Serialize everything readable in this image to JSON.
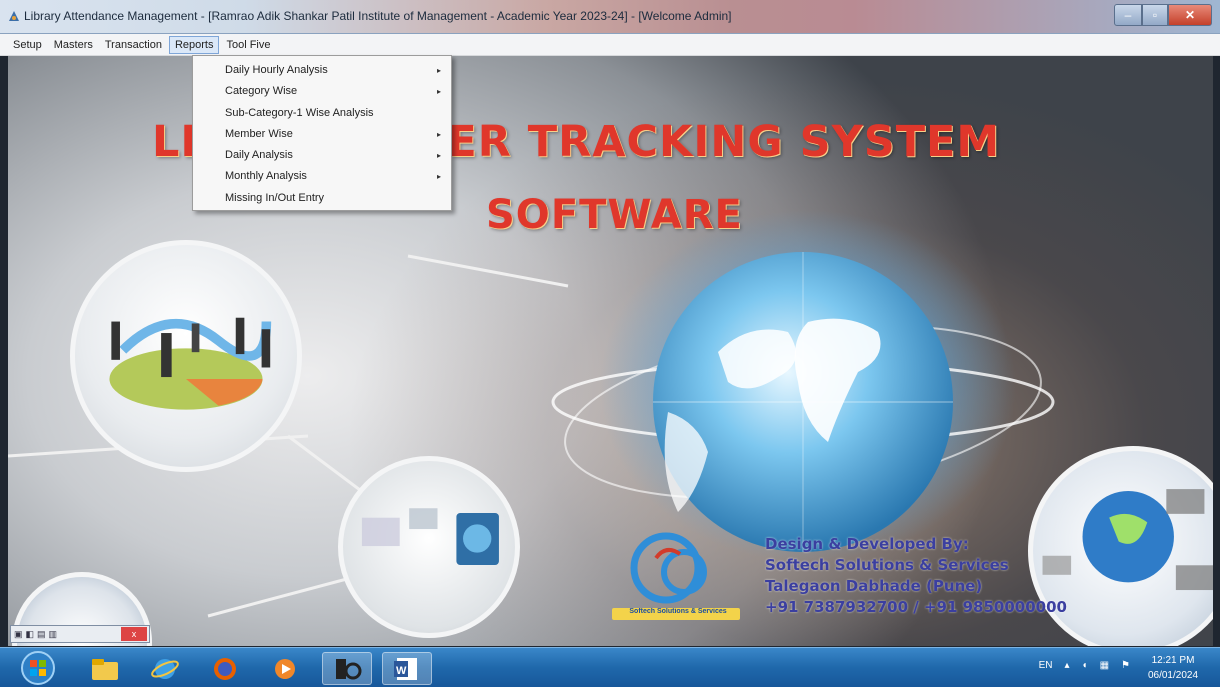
{
  "window": {
    "title": "Library Attendance Management - [Ramrao Adik Shankar Patil Institute of Management - Academic Year 2023-24] - [Welcome Admin]"
  },
  "menubar": {
    "items": [
      "Setup",
      "Masters",
      "Transaction",
      "Reports",
      "Tool Five"
    ],
    "active": "Reports"
  },
  "reports_menu": {
    "items": [
      {
        "label": "Daily Hourly Analysis",
        "has_submenu": true
      },
      {
        "label": "Category Wise",
        "has_submenu": true
      },
      {
        "label": "Sub-Category-1 Wise Analysis",
        "has_submenu": false
      },
      {
        "label": "Member Wise",
        "has_submenu": true
      },
      {
        "label": "Daily Analysis",
        "has_submenu": true
      },
      {
        "label": "Monthly Analysis",
        "has_submenu": true
      },
      {
        "label": "Missing In/Out Entry",
        "has_submenu": false
      }
    ],
    "submenu_arrow": "▸"
  },
  "splash": {
    "headline_line1": "LIBRARY USER TRACKING SYSTEM",
    "headline_line2": "SOFTWARE",
    "credits": [
      "Design & Developed By:",
      "Softech Solutions & Services",
      "Talegaon Dabhade (Pune)",
      "+91 7387932700 / +91 9850000000"
    ],
    "logo_caption": "Softech Solutions & Services"
  },
  "mini_toolbar": {
    "close_label": "x"
  },
  "taskbar": {
    "apps": [
      "start-orb",
      "file-explorer-icon",
      "internet-explorer-icon",
      "firefox-icon",
      "media-player-icon",
      "library-app-icon",
      "word-icon"
    ],
    "tray_language": "EN",
    "clock_time": "12:21 PM",
    "clock_date": "06/01/2024"
  },
  "colors": {
    "headline": "#e0372b",
    "credits": "#3b3fa0",
    "taskbar": "#1f68ab",
    "menu_highlight": "#dbe8f8"
  }
}
